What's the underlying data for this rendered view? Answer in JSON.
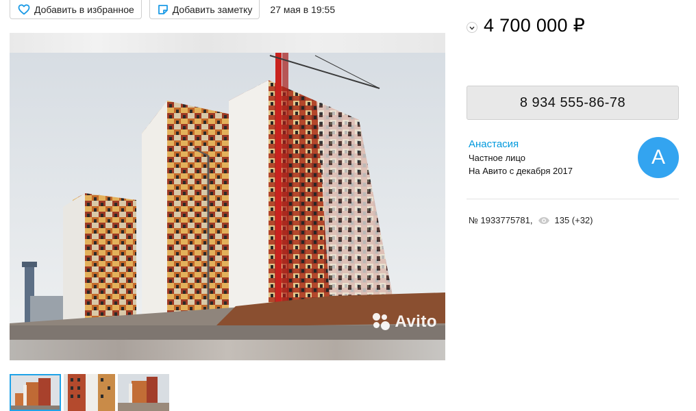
{
  "actions": {
    "favorite_label": "Добавить в избранное",
    "note_label": "Добавить заметку",
    "date": "27 мая в 19:55"
  },
  "gallery": {
    "watermark": "Avito",
    "thumbnail_count": 3
  },
  "listing": {
    "price": "4 700 000 ₽",
    "phone": "8 934 555-86-78",
    "number": "№ 1933775781,",
    "views": "135 (+32)"
  },
  "seller": {
    "name": "Анастасия",
    "type": "Частное лицо",
    "since": "На Авито с декабря 2017",
    "avatar_letter": "А"
  },
  "icons": {
    "favorite": "heart-icon",
    "note": "note-icon",
    "price_toggle": "chevron-down-icon",
    "views": "eye-icon"
  },
  "colors": {
    "accent": "#0099dd",
    "avatar": "#33a4f0",
    "thumb_active": "#1ea2e8",
    "phone_button": "#e8e8e8"
  }
}
